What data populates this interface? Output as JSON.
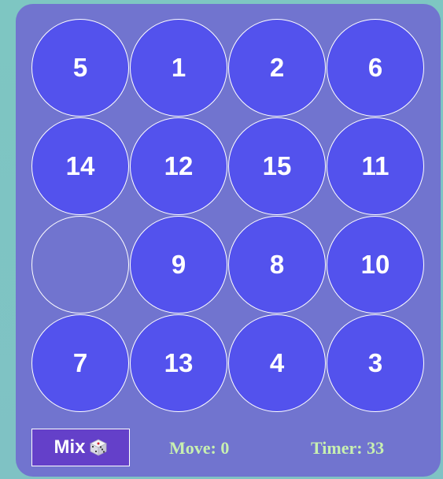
{
  "board": {
    "tiles": [
      {
        "label": "5",
        "empty": false
      },
      {
        "label": "1",
        "empty": false
      },
      {
        "label": "2",
        "empty": false
      },
      {
        "label": "6",
        "empty": false
      },
      {
        "label": "14",
        "empty": false
      },
      {
        "label": "12",
        "empty": false
      },
      {
        "label": "15",
        "empty": false
      },
      {
        "label": "11",
        "empty": false
      },
      {
        "label": "",
        "empty": true
      },
      {
        "label": "9",
        "empty": false
      },
      {
        "label": "8",
        "empty": false
      },
      {
        "label": "10",
        "empty": false
      },
      {
        "label": "7",
        "empty": false
      },
      {
        "label": "13",
        "empty": false
      },
      {
        "label": "4",
        "empty": false
      },
      {
        "label": "3",
        "empty": false
      }
    ]
  },
  "controls": {
    "mix_label": "Mix",
    "mix_icon": "dice-icon"
  },
  "stats": {
    "moves_text": "Move: 0",
    "timer_text": "Timer: 33"
  },
  "colors": {
    "background": "#7fc4c3",
    "panel": "#7174cf",
    "tile": "#5352ed",
    "tile_border": "#ffffff",
    "mix_button": "#6440c9",
    "stat_text": "#c8f0b0"
  }
}
